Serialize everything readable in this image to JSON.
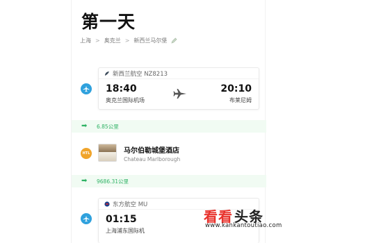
{
  "day_title": "第一天",
  "breadcrumb": [
    "上海",
    "奥克兰",
    "新西兰马尔堡"
  ],
  "breadcrumb_sep": ">",
  "flight1": {
    "airline": "新西兰航空 NZ8213",
    "depart_time": "18:40",
    "depart_airport": "奥克兰国际机场",
    "arrive_time": "20:10",
    "arrive_airport": "布莱尼姆"
  },
  "distance1": "6.85公里",
  "hotel": {
    "name": "马尔伯勒城堡酒店",
    "name_en": "Chateau Marlborough",
    "icon_label": "HTL"
  },
  "distance2": "9686.31公里",
  "flight2": {
    "airline": "东方航空 MU",
    "depart_time": "01:15",
    "depart_airport": "上海浦东国际机"
  },
  "watermark": {
    "text_red": "看看",
    "text_dark": "头条",
    "url": "www.kankantoutiao.com"
  },
  "colors": {
    "flight_icon": "#2fa1dd",
    "hotel_icon": "#f0a42a",
    "distance_green": "#2eb264",
    "distance_bg": "#f1fbf3"
  }
}
